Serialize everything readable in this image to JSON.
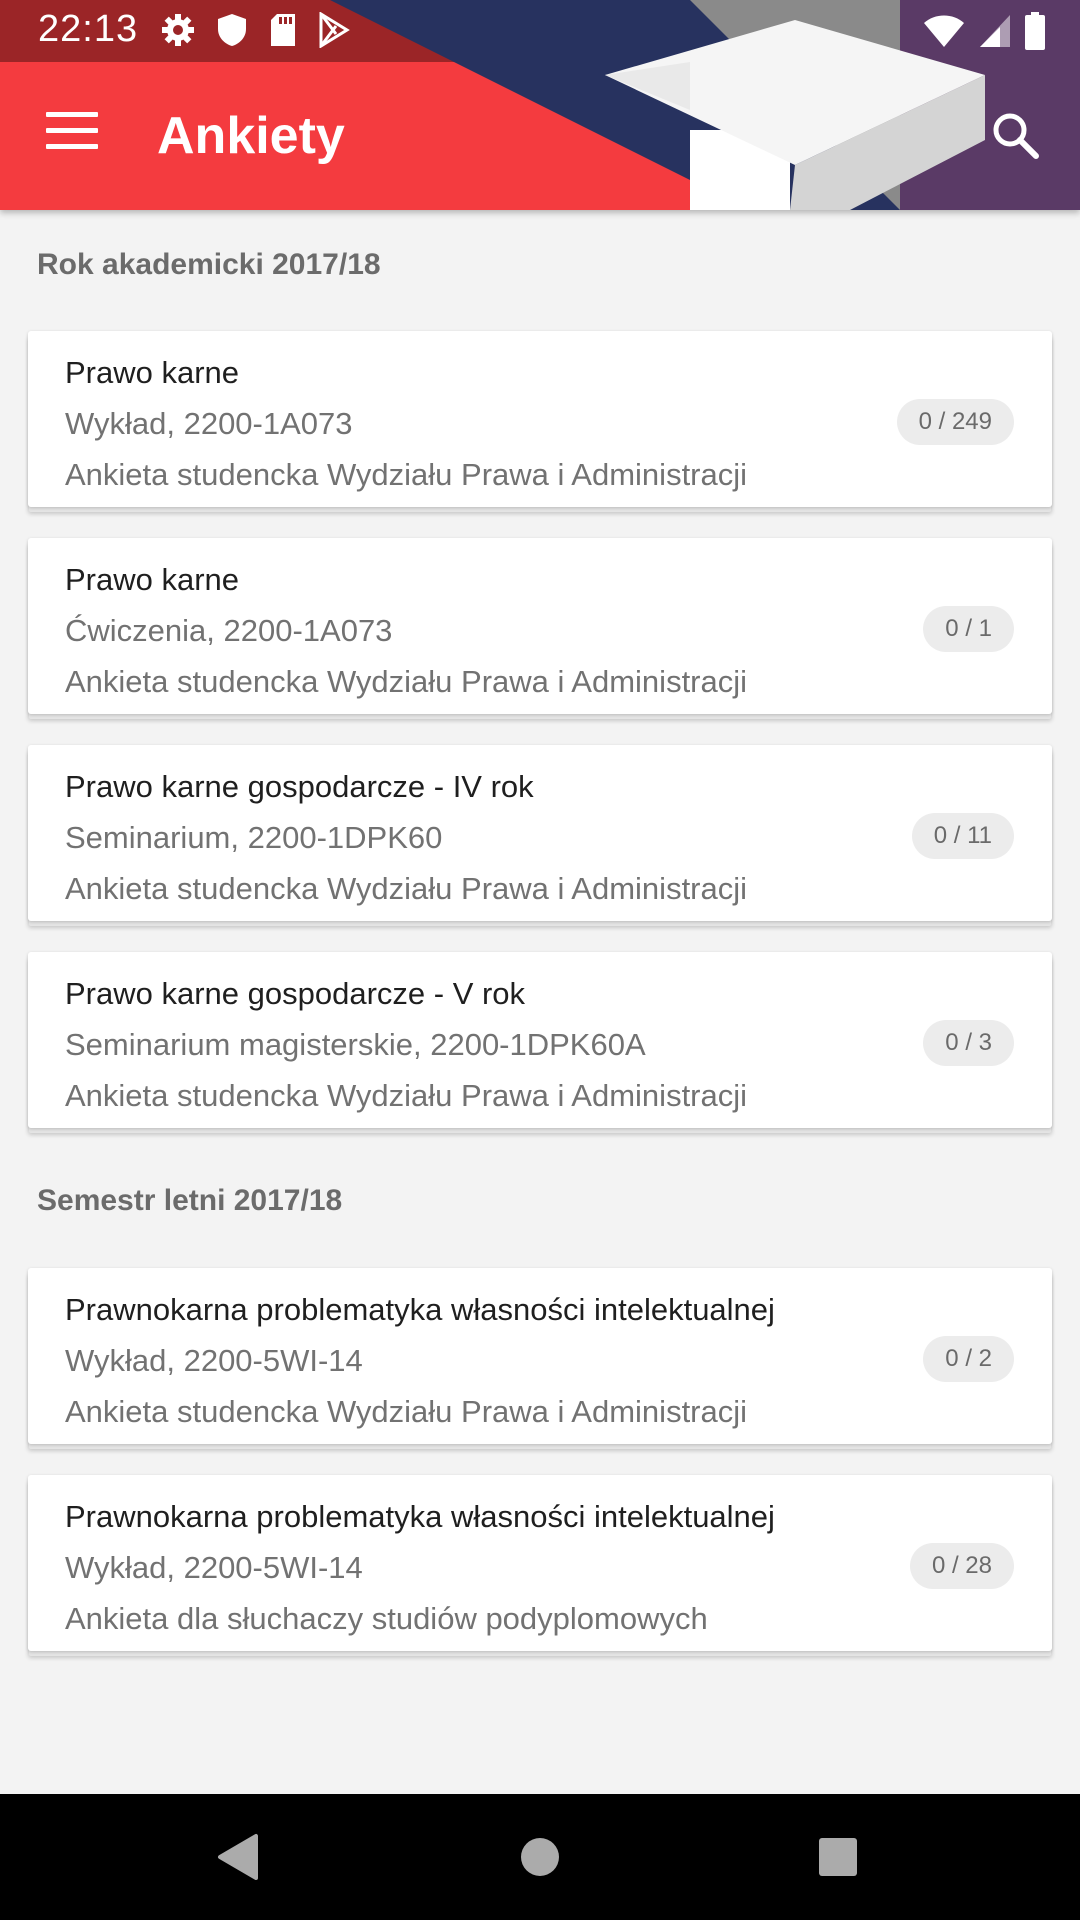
{
  "status_bar": {
    "time": "22:13",
    "left_icons": [
      "gear-icon",
      "shield-icon",
      "sd-card-icon",
      "play-store-icon"
    ],
    "right_icons": [
      "wifi-icon",
      "signal-icon",
      "battery-icon"
    ]
  },
  "app_bar": {
    "title": "Ankiety",
    "menu_icon": "menu-icon",
    "search_icon": "search-icon",
    "colors": {
      "primary": "#f43b3f",
      "navy": "#27325f",
      "purple": "#5a3a66"
    }
  },
  "sections": [
    {
      "header": "Rok akademicki 2017/18",
      "items": [
        {
          "title": "Prawo karne",
          "subtitle": "Wykład, 2200-1A073",
          "description": "Ankieta studencka Wydziału Prawa i Administracji",
          "count": "0 / 249"
        },
        {
          "title": "Prawo karne",
          "subtitle": "Ćwiczenia, 2200-1A073",
          "description": "Ankieta studencka Wydziału Prawa i Administracji",
          "count": "0 / 1"
        },
        {
          "title": "Prawo karne gospodarcze - IV rok",
          "subtitle": "Seminarium, 2200-1DPK60",
          "description": "Ankieta studencka Wydziału Prawa i Administracji",
          "count": "0 / 11"
        },
        {
          "title": "Prawo karne gospodarcze - V rok",
          "subtitle": "Seminarium magisterskie, 2200-1DPK60A",
          "description": "Ankieta studencka Wydziału Prawa i Administracji",
          "count": "0 / 3"
        }
      ]
    },
    {
      "header": "Semestr letni 2017/18",
      "items": [
        {
          "title": "Prawnokarna problematyka własności intelektualnej",
          "subtitle": "Wykład, 2200-5WI-14",
          "description": "Ankieta studencka Wydziału Prawa i Administracji",
          "count": "0 / 2"
        },
        {
          "title": "Prawnokarna problematyka własności intelektualnej",
          "subtitle": "Wykład, 2200-5WI-14",
          "description": "Ankieta dla słuchaczy studiów podyplomowych",
          "count": "0 / 28"
        }
      ]
    }
  ],
  "nav_bar": {
    "icons": [
      "back-icon",
      "home-icon",
      "recents-icon"
    ]
  }
}
